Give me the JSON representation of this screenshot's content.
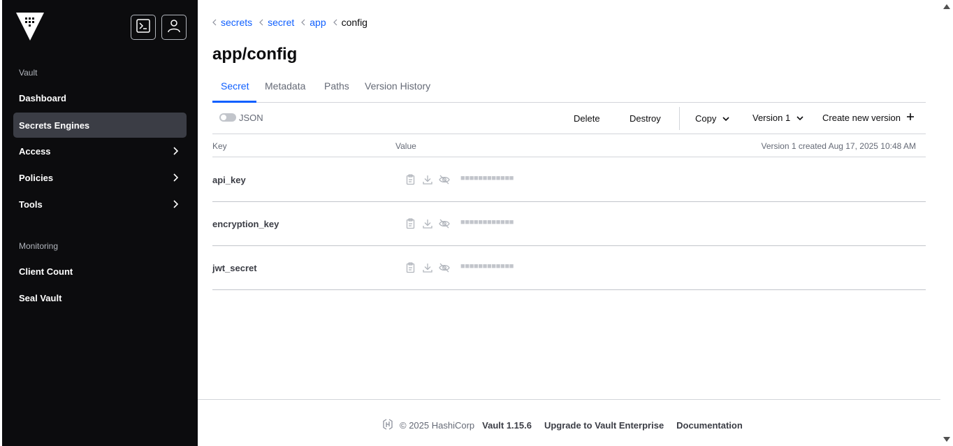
{
  "sidebar": {
    "sections": [
      {
        "title": "Vault"
      },
      {
        "title": "Monitoring"
      }
    ],
    "items": [
      {
        "label": "Dashboard"
      },
      {
        "label": "Secrets Engines"
      },
      {
        "label": "Access"
      },
      {
        "label": "Policies"
      },
      {
        "label": "Tools"
      },
      {
        "label": "Client Count"
      },
      {
        "label": "Seal Vault"
      }
    ]
  },
  "breadcrumb": [
    "secrets",
    "secret",
    "app",
    "config"
  ],
  "page_title": "app/config",
  "tabs": [
    "Secret",
    "Metadata",
    "Paths",
    "Version History"
  ],
  "toolbar": {
    "json_label": "JSON",
    "delete": "Delete",
    "destroy": "Destroy",
    "copy": "Copy",
    "version": "Version 1",
    "create_new": "Create new version"
  },
  "table": {
    "col_key": "Key",
    "col_value": "Value",
    "version_meta": "Version 1 created Aug 17, 2025 10:48 AM",
    "rows": [
      {
        "key": "api_key",
        "masked": "■■■■■■■■■■■■"
      },
      {
        "key": "encryption_key",
        "masked": "■■■■■■■■■■■■"
      },
      {
        "key": "jwt_secret",
        "masked": "■■■■■■■■■■■■"
      }
    ]
  },
  "footer": {
    "copyright": "© 2025 HashiCorp",
    "version": "Vault 1.15.6",
    "upgrade": "Upgrade to Vault Enterprise",
    "docs": "Documentation"
  },
  "colors": {
    "sidebar_bg": "#0c0c0e",
    "active_item": "#3b3d45",
    "accent": "#1060ff"
  }
}
